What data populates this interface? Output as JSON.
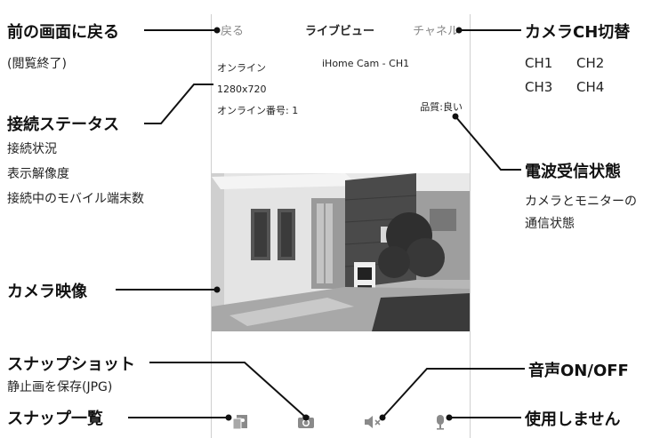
{
  "nav": {
    "back": "戻る",
    "title": "ライブビュー",
    "channel": "チャネル"
  },
  "status": {
    "online": "オンライン",
    "resolution": "1280x720",
    "online_count": "オンライン番号: 1"
  },
  "camera_name": "iHome Cam - CH1",
  "quality": "品質:良い",
  "annotations": {
    "back": {
      "title": "前の画面に戻る",
      "desc": "(閲覧終了)"
    },
    "status": {
      "title": "接続ステータス",
      "lines": [
        "接続状況",
        "表示解像度",
        "接続中のモバイル端末数"
      ]
    },
    "video": {
      "title": "カメラ映像"
    },
    "snapshot": {
      "title": "スナップショット",
      "desc": "静止画を保存(JPG)"
    },
    "snaplist": {
      "title": "スナップ一覧"
    },
    "channel": {
      "title": "カメラCH切替",
      "row1": [
        "CH1",
        "CH2"
      ],
      "row2": [
        "CH3",
        "CH4"
      ]
    },
    "signal": {
      "title": "電波受信状態",
      "lines": [
        "カメラとモニターの",
        "通信状態"
      ]
    },
    "audio": {
      "title": "音声ON/OFF"
    },
    "unused": {
      "title": "使用しません"
    }
  },
  "icons": {
    "snaplist": "snapshot-list-icon",
    "camera": "camera-icon",
    "mute": "speaker-mute-icon",
    "mic": "microphone-icon"
  }
}
